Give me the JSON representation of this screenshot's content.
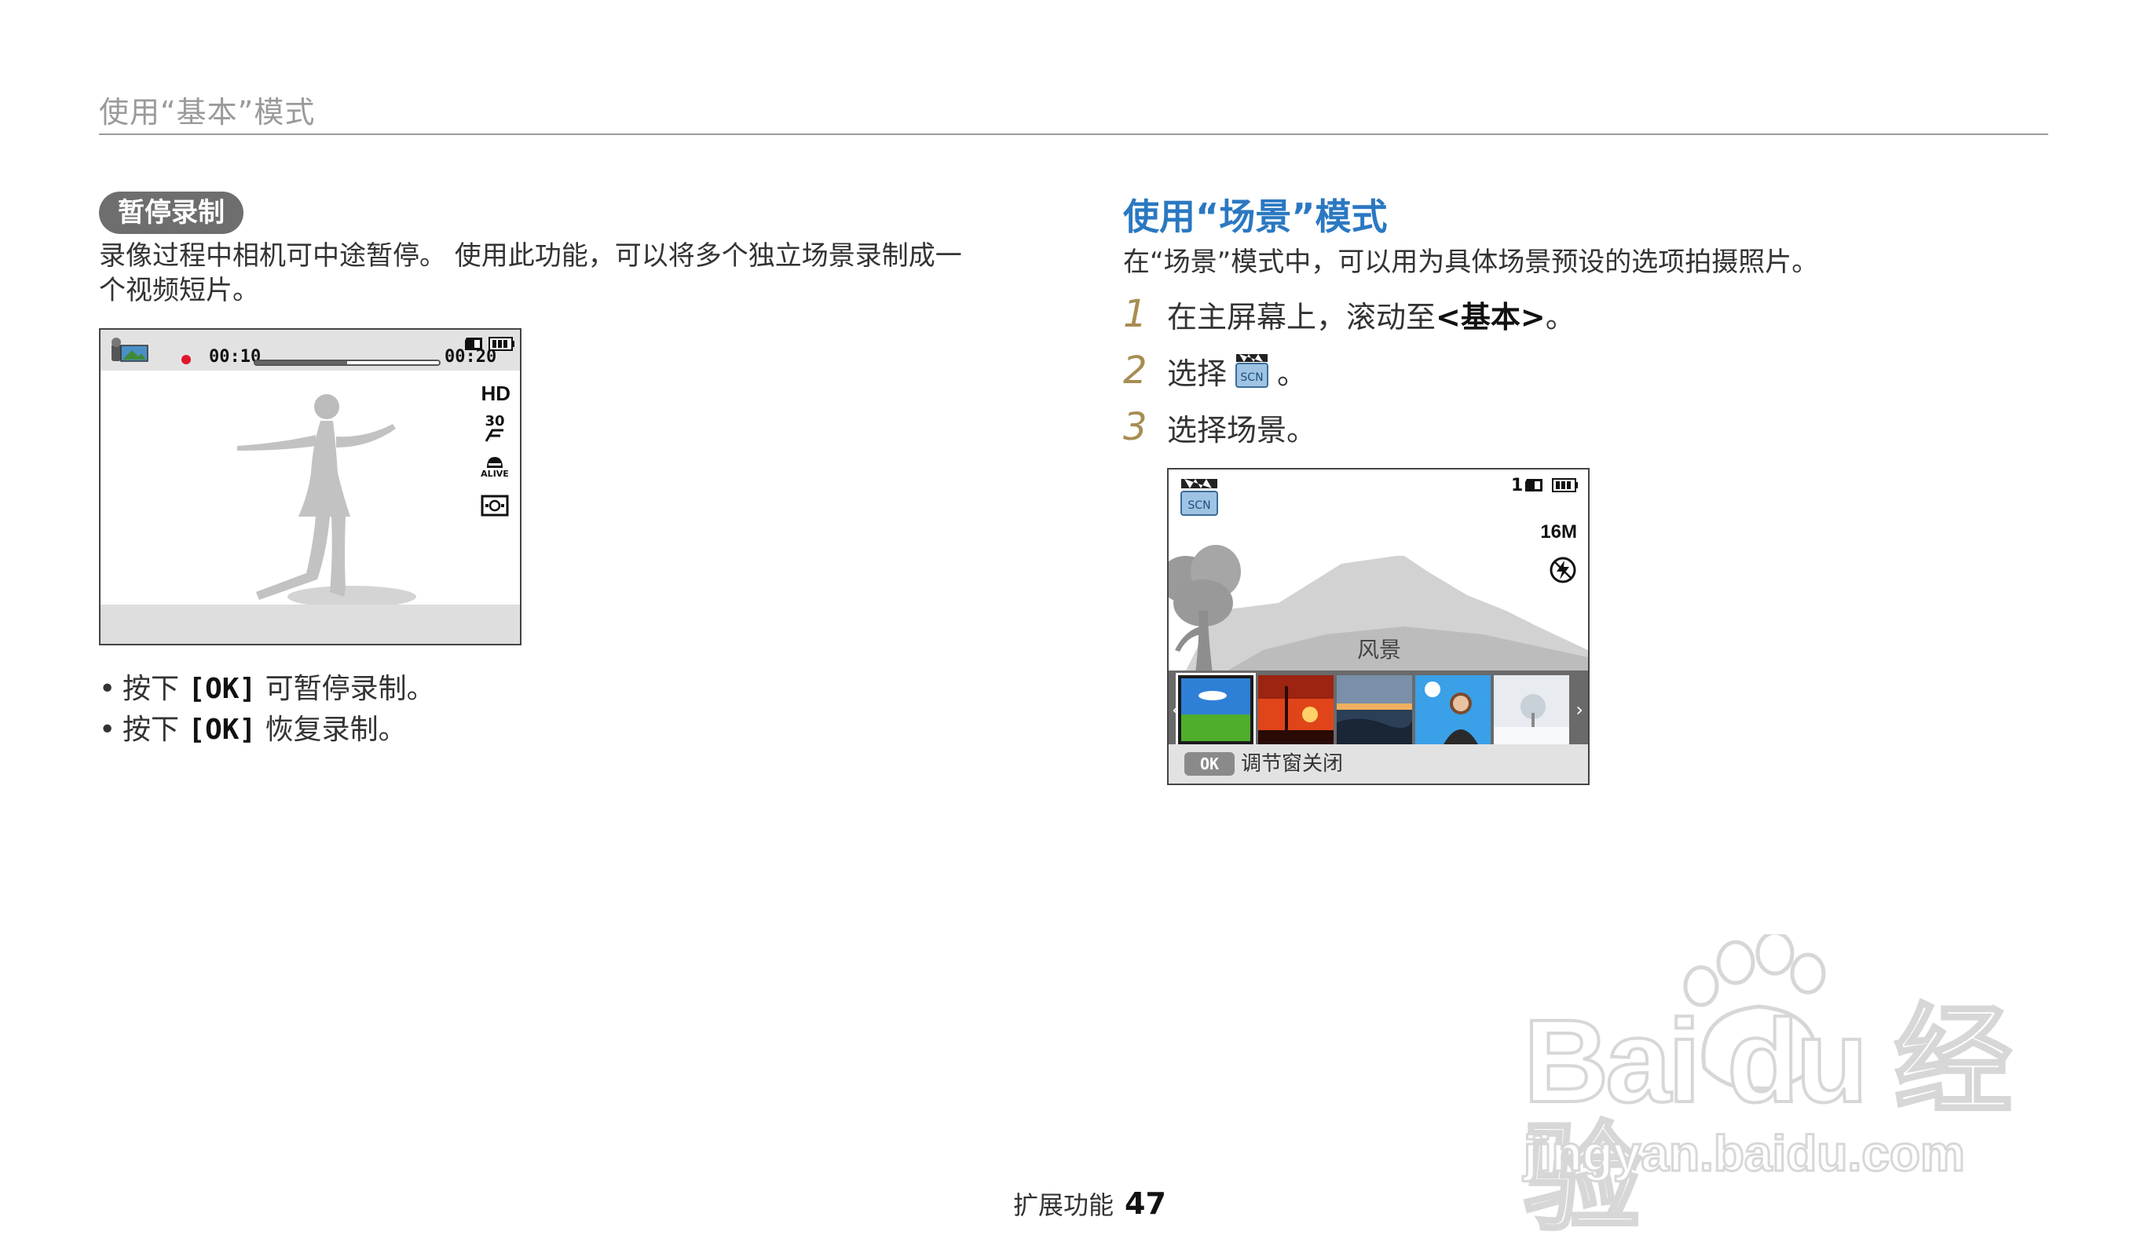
{
  "header": {
    "title": "使用“基本”模式"
  },
  "left": {
    "pill": "暂停录制",
    "paragraph_lines": [
      "录像过程中相机可中途暂停。 使用此功能，可以将多个独立场景录制成一",
      "个视频短片。"
    ],
    "screen": {
      "time_elapsed": "00:10",
      "time_total": "00:20",
      "progress": 0.5,
      "quality_label": "HD",
      "fps_label": "30",
      "alive_label": "ALIVE"
    },
    "bullets": [
      {
        "pre": "按下 ",
        "key": "[OK]",
        "post": " 可暂停录制。"
      },
      {
        "pre": "按下 ",
        "key": "[OK]",
        "post": " 恢复录制。"
      }
    ]
  },
  "right": {
    "title": "使用“场景”模式",
    "description": "在“场景”模式中，可以用为具体场景预设的选项拍摄照片。",
    "steps": [
      {
        "num": "1",
        "pre": "在主屏幕上，滚动至 ",
        "bold": "<基本>",
        "post": "。"
      },
      {
        "num": "2",
        "pre": "选择 ",
        "bold": "",
        "post": "。"
      },
      {
        "num": "3",
        "pre": "选择场景。",
        "bold": "",
        "post": ""
      }
    ],
    "screen": {
      "shots_left": "1",
      "scn_label": "SCN",
      "resolution_label": "16M",
      "scene_name": "风景",
      "ok_label": "OK",
      "close_label": "调节窗关闭"
    }
  },
  "footer": {
    "section": "扩展功能",
    "page": "47"
  },
  "watermark": {
    "brand": "Bai du 经验",
    "url": "jingyan.baidu.com"
  },
  "colors": {
    "title_blue": "#2b78c2",
    "step_gold": "#a78d52",
    "rec_red": "#e0162b"
  }
}
